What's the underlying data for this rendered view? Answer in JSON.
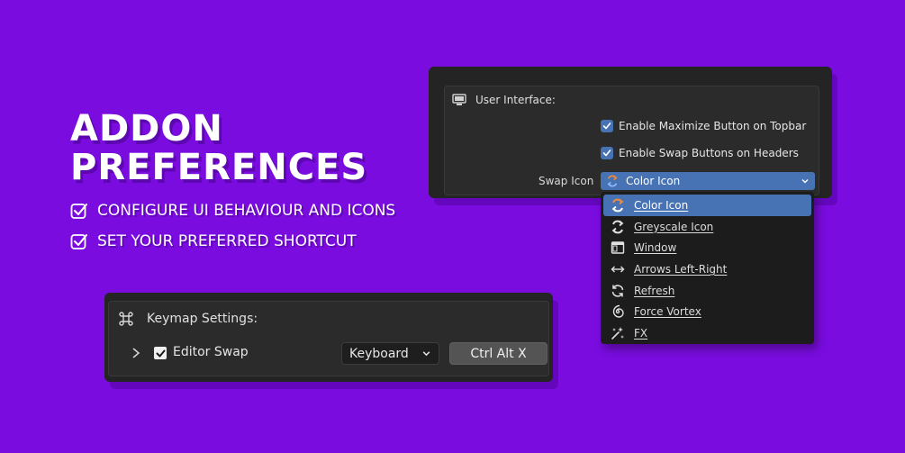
{
  "hero": {
    "title_line1": "ADDON",
    "title_line2": "PREFERENCES",
    "features": [
      "CONFIGURE UI BEHAVIOUR AND ICONS",
      "SET YOUR PREFERRED SHORTCUT"
    ]
  },
  "preferences": {
    "section_title": "User Interface:",
    "section_icon": "monitor-icon",
    "checkboxes": [
      {
        "label": "Enable Maximize Button on Topbar",
        "checked": true
      },
      {
        "label": "Enable Swap Buttons on Headers",
        "checked": true
      }
    ],
    "swap_icon_label": "Swap Icon",
    "swap_icon_value": "Color Icon"
  },
  "dropdown": {
    "items": [
      {
        "label": "Color Icon",
        "icon": "color-swap-icon",
        "selected": true
      },
      {
        "label": "Greyscale Icon",
        "icon": "greyscale-swap-icon",
        "selected": false
      },
      {
        "label": "Window",
        "icon": "window-icon",
        "selected": false
      },
      {
        "label": "Arrows Left-Right",
        "icon": "arrows-left-right-icon",
        "selected": false
      },
      {
        "label": "Refresh",
        "icon": "refresh-icon",
        "selected": false
      },
      {
        "label": "Force Vortex",
        "icon": "vortex-icon",
        "selected": false
      },
      {
        "label": "FX",
        "icon": "sparkle-icon",
        "selected": false
      }
    ]
  },
  "keymap": {
    "section_title": "Keymap Settings:",
    "section_icon": "command-key-icon",
    "entry_name": "Editor Swap",
    "entry_enabled": true,
    "input_type": "Keyboard",
    "shortcut": "Ctrl Alt X"
  },
  "colors": {
    "background": "#7a0ce0",
    "accent": "#4772b3",
    "panel": "#242424",
    "icon_orange": "#f08a3c"
  }
}
